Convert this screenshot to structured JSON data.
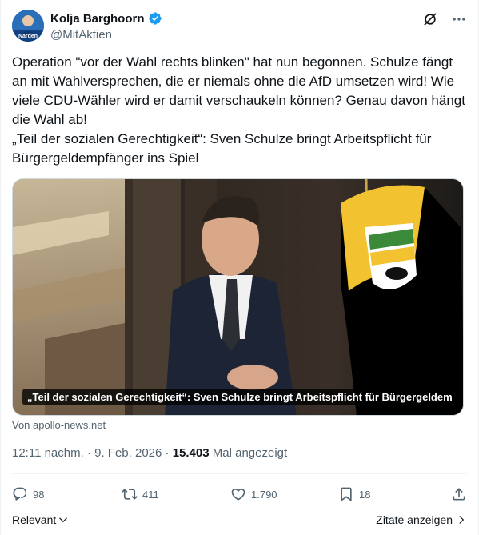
{
  "author": {
    "display_name": "Kolja Barghoorn",
    "handle": "@MitAktien",
    "avatar_badge": "Narden",
    "verified": true
  },
  "header_icons": [
    "grok-icon",
    "more-icon"
  ],
  "tweet": {
    "text": "Operation \"vor der Wahl rechts blinken\" hat nun begonnen. Schulze fängt an mit Wahlversprechen, die er niemals ohne die AfD umsetzen wird! Wie viele CDU-Wähler wird er damit verschaukeln können? Genau davon hängt die Wahl ab!\n„Teil der sozialen Gerechtigkeit“: Sven Schulze bringt Arbeitspflicht für Bürgergeldempfänger ins Spiel"
  },
  "card": {
    "caption": "„Teil der sozialen Gerechtigkeit“: Sven Schulze bringt Arbeitspflicht für Bürgergeldempf...",
    "source": "Von apollo-news.net"
  },
  "meta": {
    "time": "12:11 nachm.",
    "sep1": "·",
    "date": "9. Feb. 2026",
    "sep2": "·",
    "views": "15.403",
    "views_label": "Mal angezeigt"
  },
  "actions": {
    "replies": "98",
    "reposts": "411",
    "likes": "1.790",
    "bookmarks": "18"
  },
  "footer": {
    "sort_label": "Relevant",
    "quotes_label": "Zitate anzeigen"
  },
  "colors": {
    "accent": "#1d9bf0",
    "secondary_text": "#536471",
    "primary_text": "#0f1419"
  }
}
